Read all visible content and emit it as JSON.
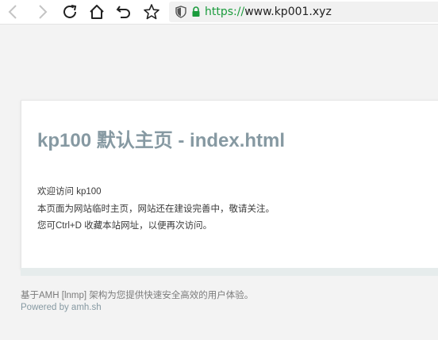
{
  "browser": {
    "url_scheme": "https://",
    "url_rest": "www.kp001.xyz",
    "icons": [
      "back-arrow-icon",
      "forward-arrow-icon",
      "reload-icon",
      "home-icon",
      "undo-icon",
      "bookmark-star-icon",
      "shield-icon",
      "lock-icon"
    ]
  },
  "page": {
    "title": "kp100 默认主页 - index.html",
    "lines": [
      "欢迎访问 kp100",
      "本页面为网站临时主页，网站还在建设完善中，敬请关注。",
      "您可Ctrl+D 收藏本站网址，以便再次访问。"
    ]
  },
  "footer": {
    "line1": "基于AMH [lnmp] 架构为您提供快速安全高效的用户体验。",
    "line2": "Powered by amh.sh"
  },
  "colors": {
    "title": "#8699a2",
    "https": "#1a9b3c",
    "background": "#f3f3f3"
  }
}
